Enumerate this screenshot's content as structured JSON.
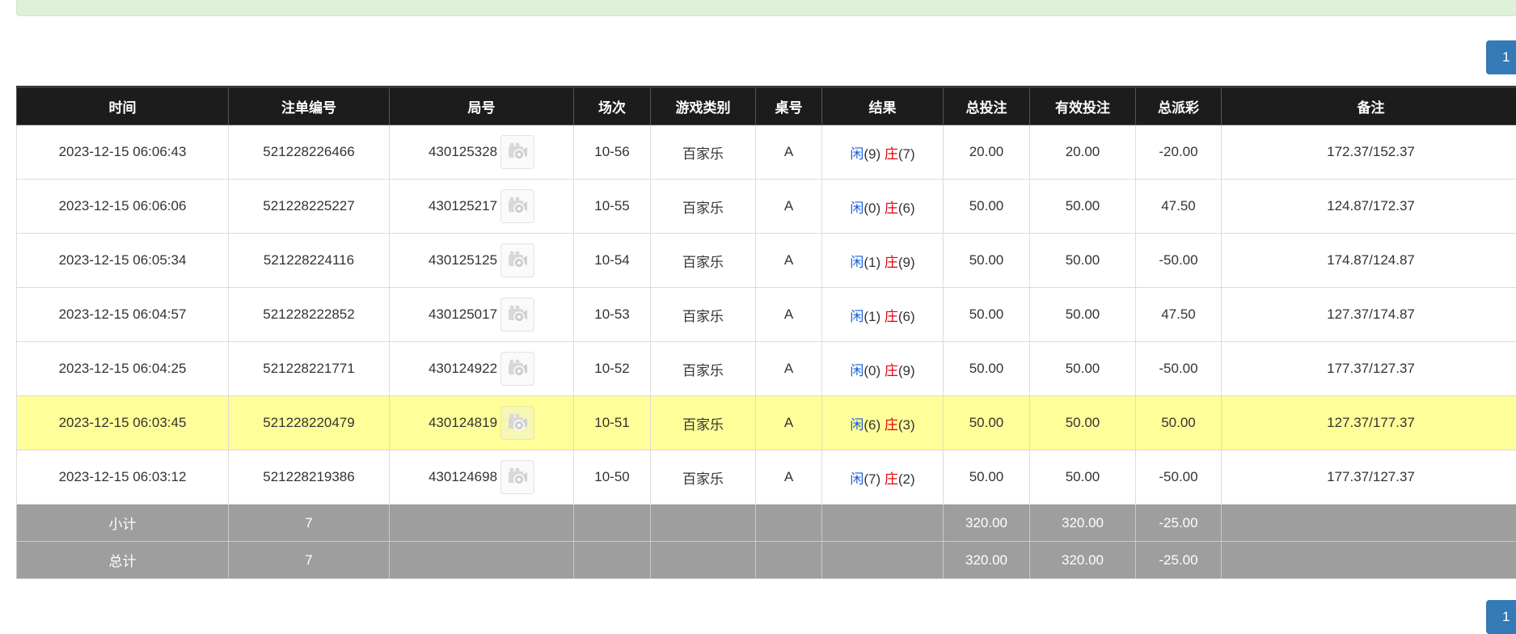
{
  "pagination": {
    "top_label": "1",
    "bottom_label": "1"
  },
  "headers": [
    "时间",
    "注单编号",
    "局号",
    "场次",
    "游戏类别",
    "桌号",
    "结果",
    "总投注",
    "有效投注",
    "总派彩",
    "备注"
  ],
  "rows": [
    {
      "time": "2023-12-15 06:06:43",
      "bet_id": "521228226466",
      "round": "430125328",
      "session": "10-56",
      "game": "百家乐",
      "table": "A",
      "player_label": "闲",
      "player_score": "(9)",
      "banker_label": "庄",
      "banker_score": "(7)",
      "total_bet": "20.00",
      "valid_bet": "20.00",
      "payout": "-20.00",
      "payout_negative": true,
      "note": "172.37/152.37",
      "highlight": false
    },
    {
      "time": "2023-12-15 06:06:06",
      "bet_id": "521228225227",
      "round": "430125217",
      "session": "10-55",
      "game": "百家乐",
      "table": "A",
      "player_label": "闲",
      "player_score": "(0)",
      "banker_label": "庄",
      "banker_score": "(6)",
      "total_bet": "50.00",
      "valid_bet": "50.00",
      "payout": "47.50",
      "payout_negative": false,
      "note": "124.87/172.37",
      "highlight": false
    },
    {
      "time": "2023-12-15 06:05:34",
      "bet_id": "521228224116",
      "round": "430125125",
      "session": "10-54",
      "game": "百家乐",
      "table": "A",
      "player_label": "闲",
      "player_score": "(1)",
      "banker_label": "庄",
      "banker_score": "(9)",
      "total_bet": "50.00",
      "valid_bet": "50.00",
      "payout": "-50.00",
      "payout_negative": true,
      "note": "174.87/124.87",
      "highlight": false
    },
    {
      "time": "2023-12-15 06:04:57",
      "bet_id": "521228222852",
      "round": "430125017",
      "session": "10-53",
      "game": "百家乐",
      "table": "A",
      "player_label": "闲",
      "player_score": "(1)",
      "banker_label": "庄",
      "banker_score": "(6)",
      "total_bet": "50.00",
      "valid_bet": "50.00",
      "payout": "47.50",
      "payout_negative": false,
      "note": "127.37/174.87",
      "highlight": false
    },
    {
      "time": "2023-12-15 06:04:25",
      "bet_id": "521228221771",
      "round": "430124922",
      "session": "10-52",
      "game": "百家乐",
      "table": "A",
      "player_label": "闲",
      "player_score": "(0)",
      "banker_label": "庄",
      "banker_score": "(9)",
      "total_bet": "50.00",
      "valid_bet": "50.00",
      "payout": "-50.00",
      "payout_negative": true,
      "note": "177.37/127.37",
      "highlight": false
    },
    {
      "time": "2023-12-15 06:03:45",
      "bet_id": "521228220479",
      "round": "430124819",
      "session": "10-51",
      "game": "百家乐",
      "table": "A",
      "player_label": "闲",
      "player_score": "(6)",
      "banker_label": "庄",
      "banker_score": "(3)",
      "total_bet": "50.00",
      "valid_bet": "50.00",
      "payout": "50.00",
      "payout_negative": false,
      "note": "127.37/177.37",
      "highlight": true
    },
    {
      "time": "2023-12-15 06:03:12",
      "bet_id": "521228219386",
      "round": "430124698",
      "session": "10-50",
      "game": "百家乐",
      "table": "A",
      "player_label": "闲",
      "player_score": "(7)",
      "banker_label": "庄",
      "banker_score": "(2)",
      "total_bet": "50.00",
      "valid_bet": "50.00",
      "payout": "-50.00",
      "payout_negative": true,
      "note": "177.37/127.37",
      "highlight": false
    }
  ],
  "summary": [
    {
      "label": "小计",
      "count": "7",
      "total_bet": "320.00",
      "valid_bet": "320.00",
      "payout": "-25.00"
    },
    {
      "label": "总计",
      "count": "7",
      "total_bet": "320.00",
      "valid_bet": "320.00",
      "payout": "-25.00"
    }
  ],
  "icons": {
    "replay": "video-replay-icon"
  },
  "colors": {
    "header_bg": "#1c1c1c",
    "highlight": "#ffff99",
    "summary_bg": "#9e9e9e",
    "blue": "#1a5ed8",
    "red": "#e8000b",
    "page_button": "#337ab7",
    "alert": "#dff0d8"
  }
}
